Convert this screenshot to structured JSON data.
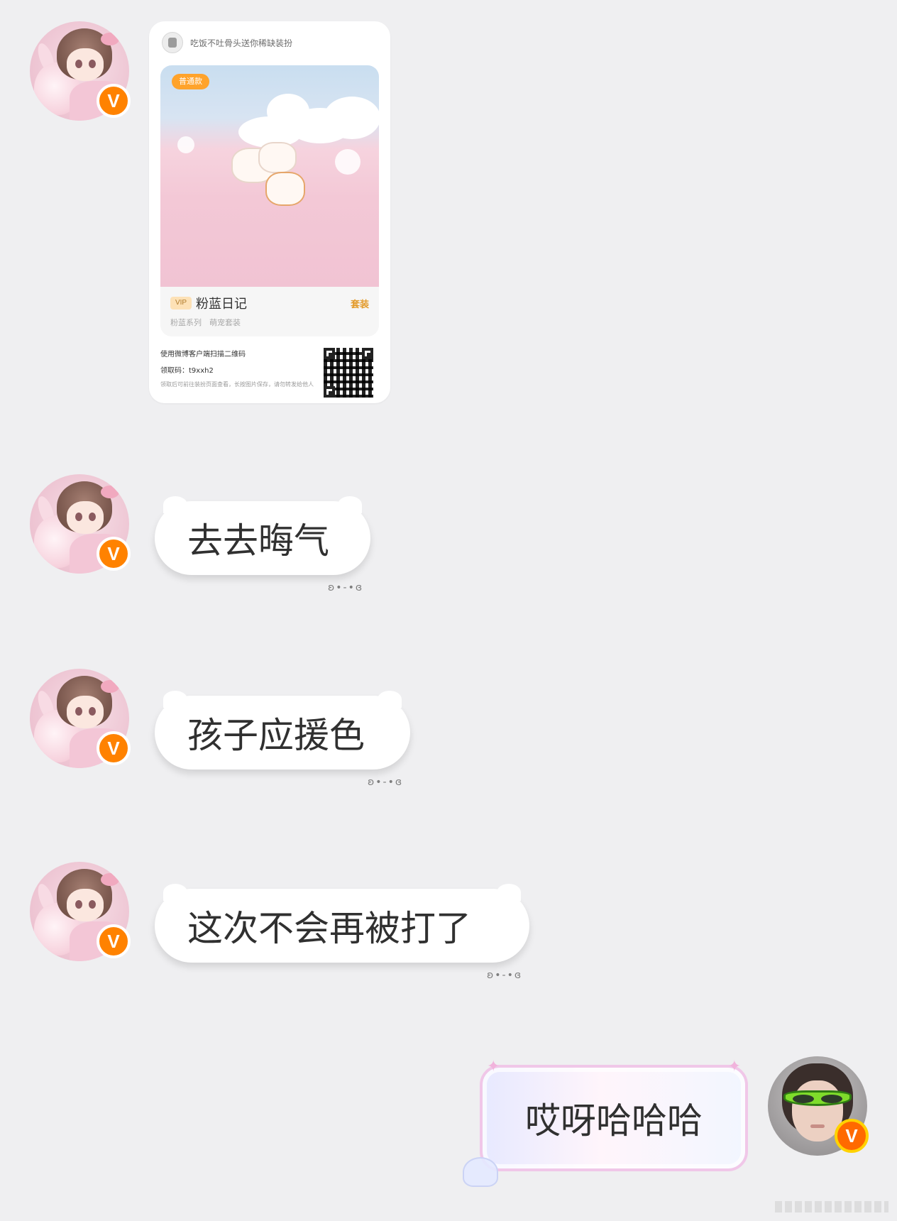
{
  "card": {
    "header_text": "吃饭不吐骨头送你稀缺装扮",
    "tag": "普通款",
    "suit_name": "粉蓝日记",
    "suit_type": "套装",
    "vip_label": "VIP",
    "suit_tags": "粉蓝系列　萌宠套装",
    "footer_line1": "使用微博客户端扫描二维码",
    "footer_line2": "领取码：t9xxh2",
    "footer_line3": "领取后可前往装扮页面查看，长按图片保存，请勿转发给他人"
  },
  "messages": [
    {
      "id": "m1",
      "text": "去去晦气",
      "deco": "ʚ•-•ɞ"
    },
    {
      "id": "m2",
      "text": "孩子应援色",
      "deco": "ʚ•-•ɞ"
    },
    {
      "id": "m3",
      "text": "这次不会再被打了",
      "deco": "ʚ•-•ɞ"
    }
  ],
  "outgoing": {
    "text": "哎呀哈哈哈"
  },
  "avatars": {
    "badge_label": "V"
  },
  "colors": {
    "background": "#efeff1",
    "badge": "#ff8200",
    "bubble": "#ffffff",
    "text": "#303030"
  }
}
